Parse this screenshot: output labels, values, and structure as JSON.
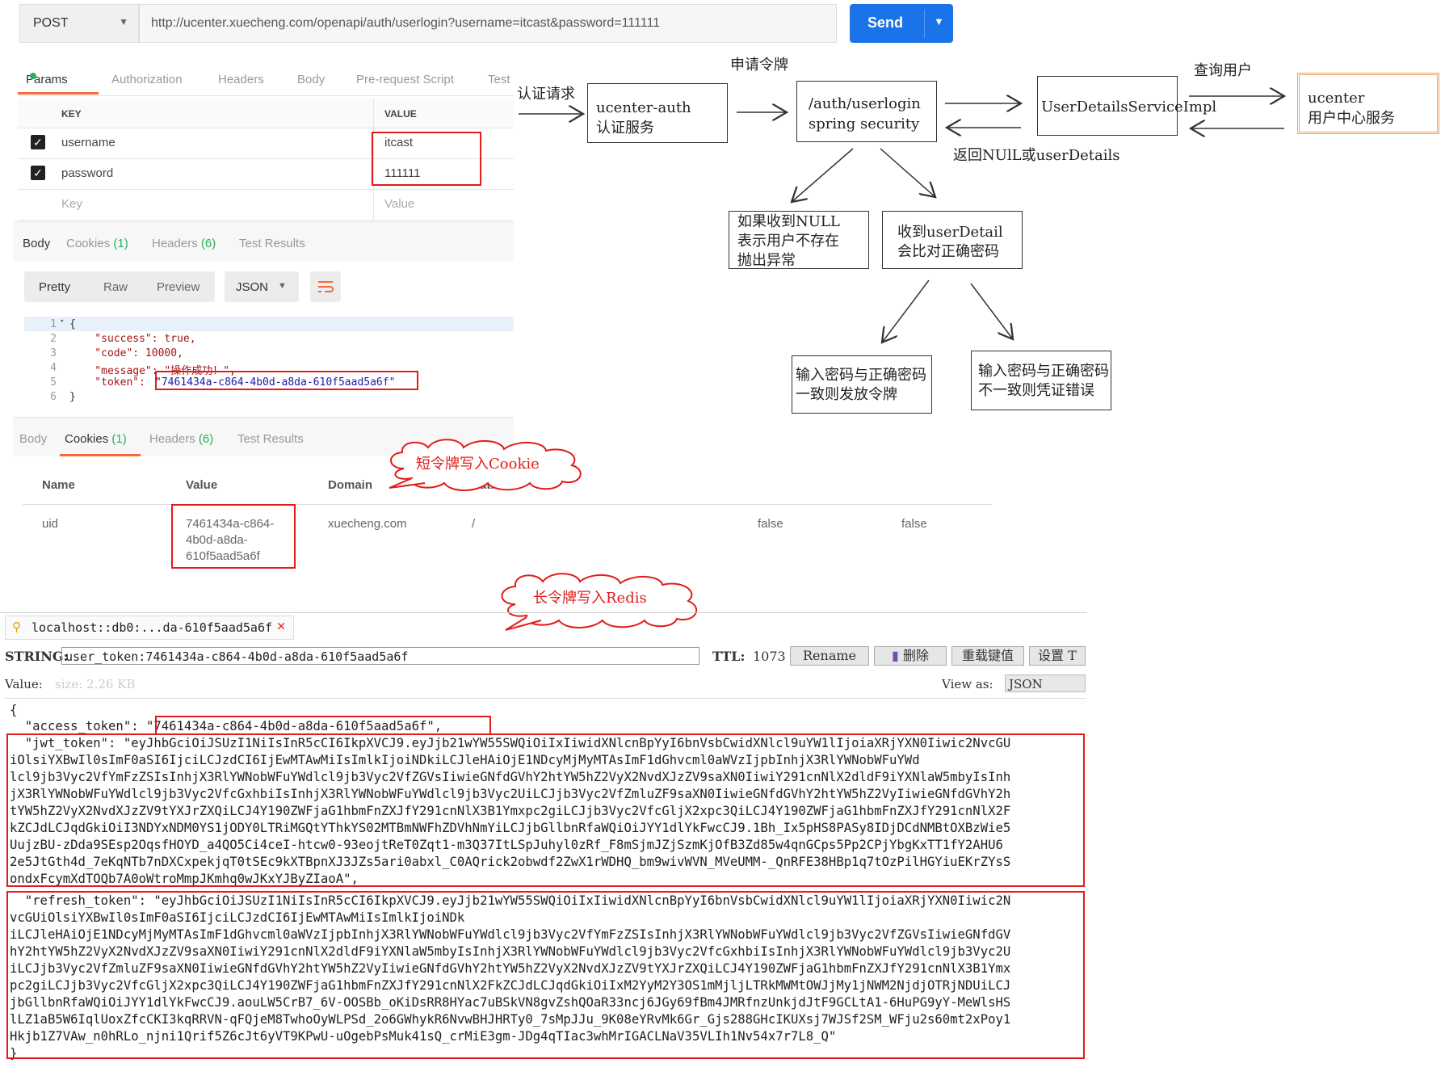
{
  "request": {
    "method": "POST",
    "url": "http://ucenter.xuecheng.com/openapi/auth/userlogin?username=itcast&password=111111",
    "send_label": "Send"
  },
  "request_tabs": [
    "Params",
    "Authorization",
    "Headers",
    "Body",
    "Pre-request Script",
    "Test"
  ],
  "params": {
    "key_header": "KEY",
    "value_header": "VALUE",
    "rows": [
      {
        "key": "username",
        "value": "itcast",
        "checked": true
      },
      {
        "key": "password",
        "value": "111111",
        "checked": true
      }
    ],
    "key_placeholder": "Key",
    "value_placeholder": "Value"
  },
  "response_tabs": {
    "body": "Body",
    "cookies": "Cookies",
    "cookies_count": "(1)",
    "headers": "Headers",
    "headers_count": "(6)",
    "test_results": "Test Results"
  },
  "body_view": {
    "pretty": "Pretty",
    "raw": "Raw",
    "preview": "Preview",
    "format": "JSON"
  },
  "response_json": {
    "line_numbers": [
      "1",
      "2",
      "3",
      "4",
      "5",
      "6"
    ],
    "lines": [
      "{",
      "    \"success\": true,",
      "    \"code\": 10000,",
      "    \"message\": \"操作成功！\",",
      "    \"token\": ",
      "}"
    ],
    "token_value": "\"7461434a-c864-4b0d-a8da-610f5aad5a6f\""
  },
  "cookies_table": {
    "headers": [
      "Name",
      "Value",
      "Domain",
      "Path"
    ],
    "row": {
      "name": "uid",
      "value_lines": [
        "7461434a-c864-",
        "4b0d-a8da-",
        "610f5aad5a6f"
      ],
      "domain": "xuecheng.com",
      "path": "/",
      "http_only": "false",
      "secure": "false"
    }
  },
  "clouds": {
    "short_token": "短令牌写入Cookie",
    "long_token": "长令牌写入Redis"
  },
  "diagram": {
    "label_auth_request": "认证请求",
    "label_apply_token": "申请令牌",
    "label_query_user": "查询用户",
    "label_return": "返回NUlL或userDetails",
    "box_ucenter_auth": [
      "ucenter-auth",
      "认证服务"
    ],
    "box_userlogin": [
      "/auth/userlogin",
      "spring security"
    ],
    "box_userdetails": "UserDetailsServiceImpl",
    "box_ucenter": [
      "ucenter",
      "用户中心服务"
    ],
    "box_null": [
      "如果收到NULL",
      "表示用户不存在",
      "抛出异常"
    ],
    "box_received": [
      "收到userDetail",
      "会比对正确密码"
    ],
    "box_match": [
      "输入密码与正确密码",
      "一致则发放令牌"
    ],
    "box_mismatch": [
      "输入密码与正确密码",
      "不一致则凭证错误"
    ],
    "accent_color": "#f5a35a"
  },
  "redis": {
    "tab_title": "localhost::db0:...da-610f5aad5a6f",
    "string_label": "STRING:",
    "key": "user_token:7461434a-c864-4b0d-a8da-610f5aad5a6f",
    "ttl_label": "TTL:",
    "ttl_value": "1073",
    "rename": "Rename",
    "delete": "删除",
    "reload": "重载键值",
    "set_ttl": "设置 T",
    "value_label": "Value:",
    "size": "size: 2.26 KB",
    "view_as_label": "View as:",
    "view_as_value": "JSON",
    "json_lines": [
      "{",
      "  \"access_token\": \"7461434a-c864-4b0d-a8da-610f5aad5a6f\",",
      "  \"jwt_token\": \"eyJhbGciOiJSUzI1NiIsInR5cCI6IkpXVCJ9.eyJjb21wYW55SWQiOiIxIiwidXNlcnBpYyI6bnVsbCwidXNlcl9uYW1lIjoiaXRjYXN0Iiwic2NvcGU",
      "iOlsiYXBwIl0sImF0aSI6IjciLCJzdCI6IjEwMTAwMiIsImlkIjoiNDkiLCJleHAiOjE1NDcyMjMyMTAsImF1dGhvcml0aWVzIjpbInhjX3RlYWNobWFuYWd",
      "lcl9jb3Vyc2VfYmFzZSIsInhjX3RlYWNobWFuYWdlcl9jb3Vyc2VfZGVsIiwieGNfdGVhY2htYW5hZ2VyX2NvdXJzZV9saXN0IiwiY291cnNlX2dldF9iYXNlaW5mbyIsInh",
      "jX3RlYWNobWFuYWdlcl9jb3Vyc2VfcGxhbiIsInhjX3RlYWNobWFuYWdlcl9jb3Vyc2UiLCJjb3Vyc2VfZmluZF9saXN0IiwieGNfdGVhY2htYW5hZ2VyIiwieGNfdGVhY2h",
      "tYW5hZ2VyX2NvdXJzZV9tYXJrZXQiLCJ4Y190ZWFjaG1hbmFnZXJfY291cnNlX3B1Ymxpc2giLCJjb3Vyc2VfcGljX2xpc3QiLCJ4Y190ZWFjaG1hbmFnZXJfY291cnNlX2F",
      "kZCJdLCJqdGkiOiI3NDYxNDM0YS1jODY0LTRiMGQtYThkYS02MTBmNWFhZDVhNmYiLCJjbGllbnRfaWQiOiJYY1dlYkFwcCJ9.1Bh_Ix5pHS8PASy8IDjDCdNMBtOXBzWie5",
      "UujzBU-zDda9SEsp2OqsfHOYD_a4QO5Ci4ceI-htcw0-93eojtReT0Zqt1-m3Q37ItLSpJuhyl0zRf_F8mSjmJZjSzmKjOfB3Zd85w4qnGCps5Pp2CPjYbgKxTT1fY2AHU6",
      "2e5JtGth4d_7eKqNTb7nDXCxpekjqT0tSEc9kXTBpnXJ3JZs5ari0abxl_C0AQrick2obwdf2ZwX1rWDHQ_bm9wivWVN_MVeUMM-_QnRFE38HBp1q7tOzPilHGYiuEKrZYsS",
      "ondxFcymXdTOQb7A0oWtroMmpJKmhq0wJKxYJByZIaoA\",",
      "  \"refresh_token\": \"eyJhbGciOiJSUzI1NiIsInR5cCI6IkpXVCJ9.eyJjb21wYW55SWQiOiIxIiwidXNlcnBpYyI6bnVsbCwidXNlcl9uYW1lIjoiaXRjYXN0Iiwic2N",
      "vcGUiOlsiYXBwIl0sImF0aSI6IjciLCJzdCI6IjEwMTAwMiIsImlkIjoiNDk",
      "iLCJleHAiOjE1NDcyMjMyMTAsImF1dGhvcml0aWVzIjpbInhjX3RlYWNobWFuYWdlcl9jb3Vyc2VfYmFzZSIsInhjX3RlYWNobWFuYWdlcl9jb3Vyc2VfZGVsIiwieGNfdGV",
      "hY2htYW5hZ2VyX2NvdXJzZV9saXN0IiwiY291cnNlX2dldF9iYXNlaW5mbyIsInhjX3RlYWNobWFuYWdlcl9jb3Vyc2VfcGxhbiIsInhjX3RlYWNobWFuYWdlcl9jb3Vyc2U",
      "iLCJjb3Vyc2VfZmluZF9saXN0IiwieGNfdGVhY2htYW5hZ2VyIiwieGNfdGVhY2htYW5hZ2VyX2NvdXJzZV9tYXJrZXQiLCJ4Y190ZWFjaG1hbmFnZXJfY291cnNlX3B1Ymx",
      "pc2giLCJjb3Vyc2VfcGljX2xpc3QiLCJ4Y190ZWFjaG1hbmFnZXJfY291cnNlX2FkZCJdLCJqdGkiOiIxM2YyM2Y3OS1mMjljLTRkMWMtOWJjMy1jNWM2NjdjOTRjNDUiLCJ",
      "jbGllbnRfaWQiOiJYY1dlYkFwcCJ9.aouLW5CrB7_6V-OOSBb_oKiDsRR8HYac7uBSkVN8gvZshQOaR33ncj6JGy69fBm4JMRfnzUnkjdJtF9GCLtA1-6HuPG9yY-MeWlsHS",
      "lLZ1aB5W6IqlUoxZfcCKI3kqRRVN-qFQjeM8TwhoOyWLPSd_2o6GWhykR6NvwBHJHRTy0_7sMpJJu_9K08eYRvMk6Gr_Gjs288GHcIKUXsj7WJSf2SM_WFju2s60mt2xPoy1",
      "Hkjb1Z7VAw_n0hRLo_njni1Qrif5Z6cJt6yVT9KPwU-uOgebPsMuk41sQ_crMiE3gm-JDg4qTIac3whMrIGACLNaV35VLIh1Nv54x7r7L8_Q\"",
      "}"
    ]
  }
}
